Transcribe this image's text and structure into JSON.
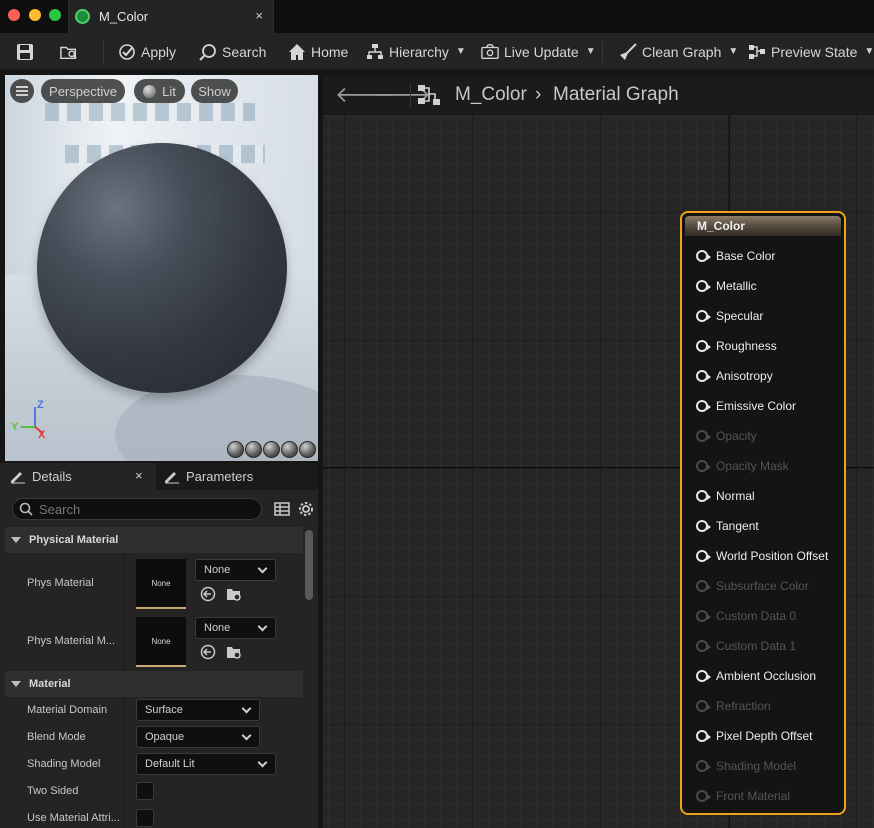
{
  "window": {
    "tab_title": "M_Color",
    "tab_close": "×",
    "tab_icon": "material-sphere-icon"
  },
  "toolbar": {
    "apply": "Apply",
    "search": "Search",
    "home": "Home",
    "hierarchy": "Hierarchy",
    "live_update": "Live Update",
    "clean_graph": "Clean Graph",
    "preview_state": "Preview State"
  },
  "viewport": {
    "perspective": "Perspective",
    "lit": "Lit",
    "show": "Show",
    "axis_z": "Z",
    "axis_y": "Y",
    "axis_x": "X",
    "axis_colors": {
      "x": "#e23b3b",
      "y": "#56c23a",
      "z": "#4a7bd8"
    }
  },
  "panel": {
    "details_tab": "Details",
    "details_close": "×",
    "parameters_tab": "Parameters",
    "search_placeholder": "Search",
    "physical_material": {
      "header": "Physical Material",
      "rows": [
        {
          "name": "Phys Material",
          "thumb": "None",
          "combo": "None"
        },
        {
          "name": "Phys Material M...",
          "thumb": "None",
          "combo": "None"
        }
      ]
    },
    "material": {
      "header": "Material",
      "rows": [
        {
          "name": "Material Domain",
          "value": "Surface"
        },
        {
          "name": "Blend Mode",
          "value": "Opaque"
        },
        {
          "name": "Shading Model",
          "value": "Default Lit"
        },
        {
          "name": "Two Sided",
          "value": ""
        },
        {
          "name": "Use Material Attri...",
          "value": ""
        }
      ]
    }
  },
  "graph": {
    "back": "🡐",
    "forward": "🡒",
    "crumb_root": "M_Color",
    "crumb_sep": "›",
    "crumb_current": "Material Graph",
    "accent": "#f0a21a"
  },
  "node": {
    "title": "M_Color",
    "pins": [
      {
        "label": "Base Color",
        "enabled": true
      },
      {
        "label": "Metallic",
        "enabled": true
      },
      {
        "label": "Specular",
        "enabled": true
      },
      {
        "label": "Roughness",
        "enabled": true
      },
      {
        "label": "Anisotropy",
        "enabled": true
      },
      {
        "label": "Emissive Color",
        "enabled": true
      },
      {
        "label": "Opacity",
        "enabled": false
      },
      {
        "label": "Opacity Mask",
        "enabled": false
      },
      {
        "label": "Normal",
        "enabled": true
      },
      {
        "label": "Tangent",
        "enabled": true
      },
      {
        "label": "World Position Offset",
        "enabled": true
      },
      {
        "label": "Subsurface Color",
        "enabled": false
      },
      {
        "label": "Custom Data 0",
        "enabled": false
      },
      {
        "label": "Custom Data 1",
        "enabled": false
      },
      {
        "label": "Ambient Occlusion",
        "enabled": true
      },
      {
        "label": "Refraction",
        "enabled": false
      },
      {
        "label": "Pixel Depth Offset",
        "enabled": true
      },
      {
        "label": "Shading Model",
        "enabled": false
      },
      {
        "label": "Front Material",
        "enabled": false
      }
    ]
  }
}
